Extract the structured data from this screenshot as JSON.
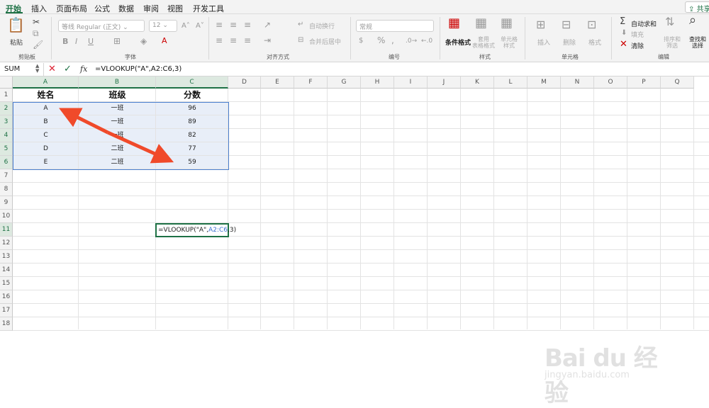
{
  "tabs": [
    "开始",
    "插入",
    "页面布局",
    "公式",
    "数据",
    "审阅",
    "视图",
    "开发工具"
  ],
  "share_label": "共享",
  "ribbon": {
    "paste_label": "粘贴",
    "clipboard_group": "剪贴板",
    "font_name": "等线 Regular (正文)",
    "font_size": "12",
    "font_group": "字体",
    "wrap_text": "自动换行",
    "merge_center": "合并后居中",
    "align_group": "对齐方式",
    "number_format": "常规",
    "number_group": "编号",
    "cond_format": "条件格式",
    "table_format": "套用\n表格格式",
    "cell_style": "单元格\n样式",
    "style_group": "样式",
    "insert": "插入",
    "delete": "删除",
    "format": "格式",
    "cells_group": "单元格",
    "autosum": "自动求和",
    "fill": "填充",
    "clear": "清除",
    "sort_filter": "排序和\n筛选",
    "find_select": "查找和\n选择",
    "edit_group": "编辑",
    "bold": "B",
    "italic": "I",
    "underline": "U",
    "currency": "$",
    "percent": "%",
    "comma": ","
  },
  "formula_bar": {
    "name_box": "SUM",
    "fx": "fx",
    "content": "=VLOOKUP(\"A\",A2:C6,3)"
  },
  "columns": [
    "A",
    "B",
    "C",
    "D",
    "E",
    "F",
    "G",
    "H",
    "I",
    "J",
    "K",
    "L",
    "M",
    "N",
    "O",
    "P",
    "Q"
  ],
  "rows": [
    "1",
    "2",
    "3",
    "4",
    "5",
    "6",
    "7",
    "8",
    "9",
    "10",
    "11",
    "12",
    "13",
    "14",
    "15",
    "16",
    "17",
    "18"
  ],
  "table": {
    "headers": [
      "姓名",
      "班级",
      "分数"
    ],
    "data": [
      [
        "A",
        "一班",
        "96"
      ],
      [
        "B",
        "一班",
        "89"
      ],
      [
        "C",
        "一班",
        "82"
      ],
      [
        "D",
        "二班",
        "77"
      ],
      [
        "E",
        "二班",
        "59"
      ]
    ]
  },
  "active_cell": {
    "prefix": "=VLOOKUP(\"A\",",
    "range": "A2:C6",
    "suffix": ",3)"
  },
  "watermark": {
    "logo": "Bai du 经验",
    "url": "jingyan.baidu.com"
  }
}
